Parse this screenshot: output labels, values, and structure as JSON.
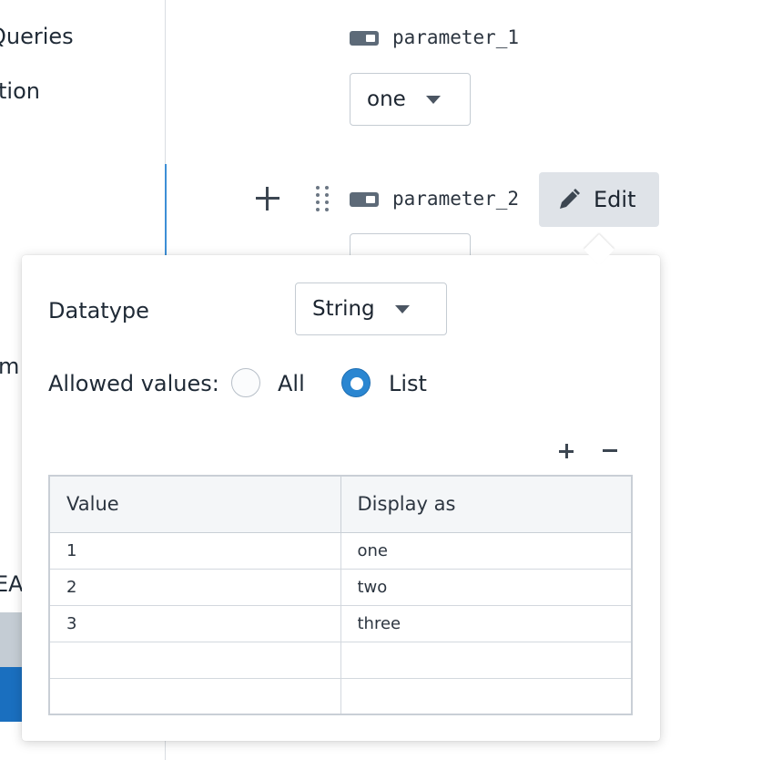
{
  "sidebar": {
    "items": [
      "Queries",
      "tion",
      "m",
      "EA"
    ]
  },
  "parameters": [
    {
      "name": "parameter_1",
      "selected_value": "one"
    },
    {
      "name": "parameter_2",
      "edit_label": "Edit"
    }
  ],
  "popover": {
    "datatype_label": "Datatype",
    "datatype_value": "String",
    "allowed_values_label": "Allowed values:",
    "allowed_options": [
      {
        "label": "All",
        "selected": false
      },
      {
        "label": "List",
        "selected": true
      }
    ],
    "table": {
      "columns": [
        "Value",
        "Display as"
      ],
      "rows": [
        [
          "1",
          "one"
        ],
        [
          "2",
          "two"
        ],
        [
          "3",
          "three"
        ],
        [
          "",
          ""
        ],
        [
          "",
          ""
        ]
      ]
    }
  },
  "colors": {
    "accent": "#2a86d1",
    "edit_button_bg": "#dfe3e8",
    "sidebar_active": "#1a6fbf"
  },
  "icons": [
    "toggle-icon",
    "plus-icon",
    "drag-handle-icon",
    "pencil-icon",
    "caret-down-icon"
  ]
}
